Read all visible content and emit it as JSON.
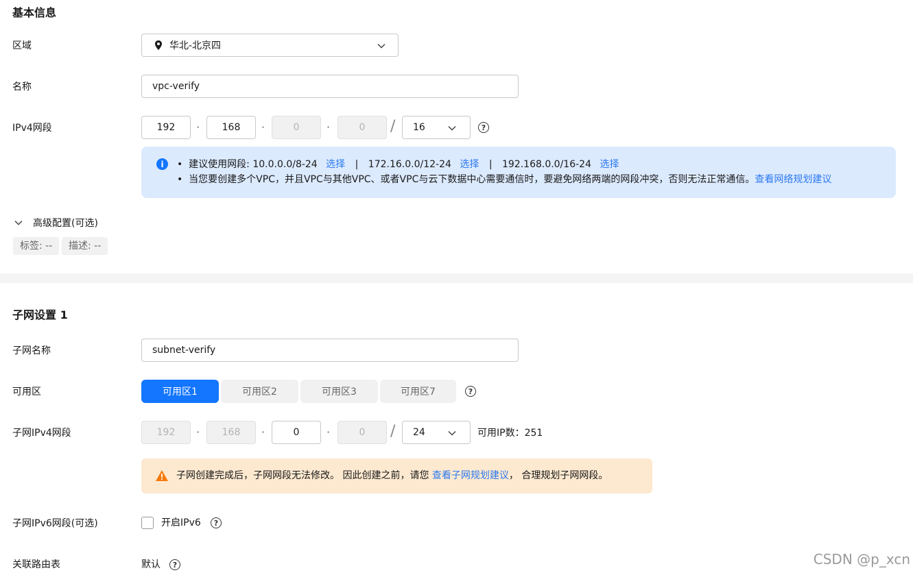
{
  "basic": {
    "title": "基本信息",
    "region_label": "区域",
    "region_value": "华北-北京四",
    "name_label": "名称",
    "name_value": "vpc-verify",
    "ipv4_label": "IPv4网段",
    "ip": [
      "192",
      "168",
      "0",
      "0"
    ],
    "mask": "16",
    "info": {
      "line1_prefix": "建议使用网段: 10.0.0.0/8-24",
      "select": "选择",
      "sep": "|",
      "range2": "172.16.0.0/12-24",
      "range3": "192.168.0.0/16-24",
      "line2": "当您要创建多个VPC，并且VPC与其他VPC、或者VPC与云下数据中心需要通信时，要避免网络两端的网段冲突，否则无法正常通信。",
      "line2_link": "查看网络规划建议"
    },
    "advanced_label": "高级配置(可选)",
    "tag_label": "标签: --",
    "desc_label": "描述: --"
  },
  "subnet": {
    "title": "子网设置 1",
    "name_label": "子网名称",
    "name_value": "subnet-verify",
    "az_label": "可用区",
    "az_options": [
      "可用区1",
      "可用区2",
      "可用区3",
      "可用区7"
    ],
    "az_selected": "可用区1",
    "ipv4_label": "子网IPv4网段",
    "ip": [
      "192",
      "168",
      "0",
      "0"
    ],
    "mask": "24",
    "available_ip": "可用IP数：251",
    "warn": {
      "text1": "子网创建完成后，子网网段无法修改。 因此创建之前，请您",
      "link": "查看子网规划建议",
      "text2": "， 合理规划子网网段。"
    },
    "ipv6_label": "子网IPv6网段(可选)",
    "ipv6_toggle": "开启IPv6",
    "route_label": "关联路由表",
    "route_value": "默认"
  },
  "watermark": "CSDN @p_xcn",
  "colors": {
    "accent": "#1476ff",
    "link": "#2c79f0",
    "info_bg": "#dceafe",
    "warn_bg": "#fde9d0",
    "warn_icon": "#f77a0b"
  }
}
